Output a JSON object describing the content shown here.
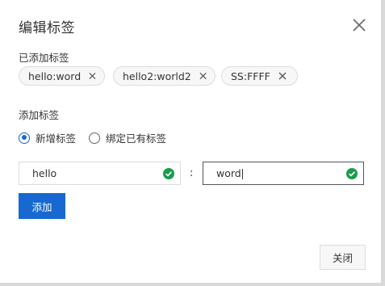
{
  "dialog": {
    "title": "编辑标签",
    "close_icon": "close-icon"
  },
  "existing_tags": {
    "label": "已添加标签",
    "tags": [
      {
        "text": "hello:word"
      },
      {
        "text": "hello2:world2"
      },
      {
        "text": "SS:FFFF"
      }
    ]
  },
  "add_section": {
    "label": "添加标签",
    "radio_options": [
      {
        "label": "新增标签",
        "checked": true
      },
      {
        "label": "绑定已有标签",
        "checked": false
      }
    ],
    "key_input": {
      "value": "hello",
      "valid": true
    },
    "separator": ":",
    "value_input": {
      "value": "word",
      "valid": true
    },
    "add_button_label": "添加"
  },
  "footer": {
    "close_button_label": "关闭"
  },
  "colors": {
    "primary": "#1769d1",
    "valid_check": "#1a9c4d",
    "border": "#dcdcdc"
  }
}
